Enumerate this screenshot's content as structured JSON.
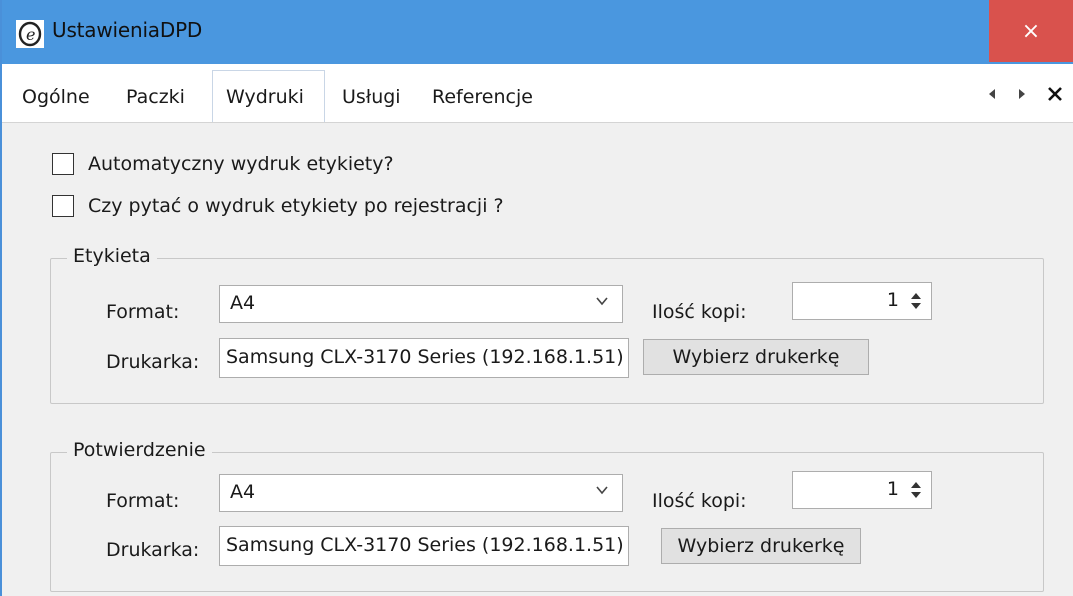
{
  "window": {
    "title": "UstawieniaDPD",
    "close_label": "×"
  },
  "tabs": [
    {
      "label": "Ogólne"
    },
    {
      "label": "Paczki"
    },
    {
      "label": "Wydruki",
      "active": true
    },
    {
      "label": "Usługi"
    },
    {
      "label": "Referencje"
    }
  ],
  "tab_nav": {
    "prev": "◀",
    "next": "▶",
    "close": "✕"
  },
  "options": {
    "auto_print_label": "Automatyczny wydruk etykiety?",
    "auto_print_checked": false,
    "ask_print_label": "Czy pytać o wydruk etykiety po rejestracji ?",
    "ask_print_checked": false
  },
  "etykieta": {
    "legend": "Etykieta",
    "format_label": "Format:",
    "format_value": "A4",
    "copies_label": "Ilość kopi:",
    "copies_value": "1",
    "printer_label": "Drukarka:",
    "printer_value": "Samsung CLX-3170 Series (192.168.1.51)",
    "choose_printer": "Wybierz drukerkę"
  },
  "potwierdzenie": {
    "legend": "Potwierdzenie",
    "format_label": "Format:",
    "format_value": "A4",
    "copies_label": "Ilość kopi:",
    "copies_value": "1",
    "printer_label": "Drukarka:",
    "printer_value": "Samsung CLX-3170 Series (192.168.1.51)",
    "choose_printer": "Wybierz drukerkę"
  },
  "colors": {
    "titlebar": "#4a97df",
    "close_button": "#d9524d"
  }
}
